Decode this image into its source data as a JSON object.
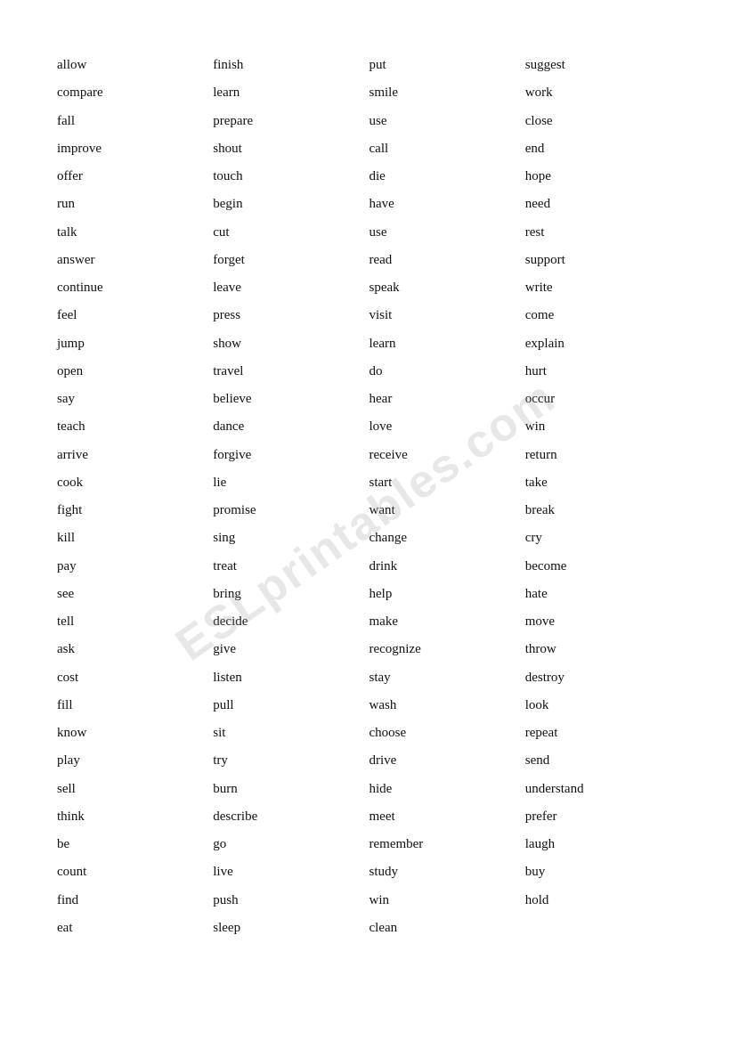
{
  "watermark": "ESLprintables.com",
  "columns": [
    [
      "allow",
      "compare",
      "fall",
      "improve",
      "offer",
      "run",
      "talk",
      "answer",
      "continue",
      "feel",
      "jump",
      "open",
      "say",
      "teach",
      "arrive",
      "cook",
      "fight",
      "kill",
      "pay",
      "see",
      "tell",
      "ask",
      "cost",
      "fill",
      "know",
      "play",
      "sell",
      "think",
      "be",
      "count",
      "find",
      "eat"
    ],
    [
      "finish",
      "learn",
      "prepare",
      "shout",
      "touch",
      "begin",
      "cut",
      "forget",
      "leave",
      "press",
      "show",
      "travel",
      "believe",
      "dance",
      "forgive",
      "lie",
      "promise",
      "sing",
      "treat",
      "bring",
      "decide",
      "give",
      "listen",
      "pull",
      "sit",
      "try",
      "burn",
      "describe",
      "go",
      "live",
      "push",
      "sleep"
    ],
    [
      "put",
      "smile",
      "use",
      "call",
      "die",
      "have",
      "use",
      "read",
      "speak",
      "visit",
      "learn",
      "do",
      "hear",
      "love",
      "receive",
      "start",
      "want",
      "change",
      "drink",
      "help",
      "make",
      "recognize",
      "stay",
      "wash",
      "choose",
      "drive",
      "hide",
      "meet",
      "remember",
      "study",
      "win",
      "clean"
    ],
    [
      "suggest",
      "work",
      "close",
      "end",
      "hope",
      "need",
      "rest",
      "support",
      "write",
      "come",
      "explain",
      "hurt",
      "occur",
      "win",
      "return",
      "take",
      "break",
      "cry",
      "become",
      "hate",
      "move",
      "throw",
      "destroy",
      "look",
      "repeat",
      "send",
      "understand",
      "prefer",
      "laugh",
      "buy",
      "hold",
      ""
    ]
  ]
}
